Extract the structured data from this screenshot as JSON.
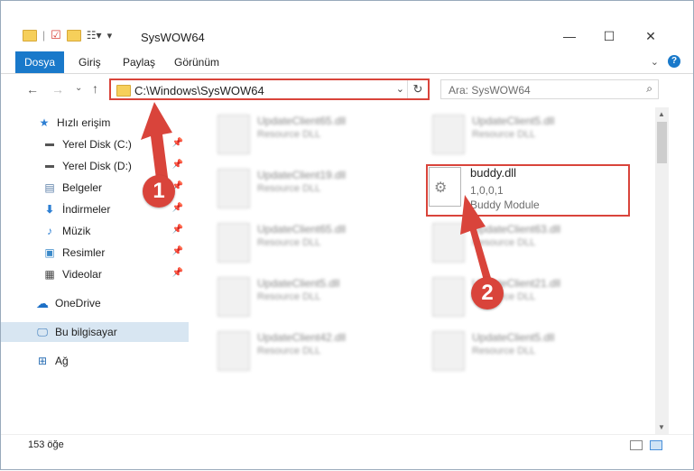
{
  "window": {
    "title": "SysWOW64"
  },
  "ribbon": {
    "tabs": [
      "Dosya",
      "Giriş",
      "Paylaş",
      "Görünüm"
    ]
  },
  "address": {
    "path": "C:\\Windows\\SysWOW64"
  },
  "search": {
    "placeholder": "Ara: SysWOW64"
  },
  "sidebar": {
    "items": [
      {
        "label": "Hızlı erişim",
        "icon": "star-icon",
        "pinned": false
      },
      {
        "label": "Yerel Disk (C:)",
        "icon": "drive-icon",
        "pinned": true
      },
      {
        "label": "Yerel Disk (D:)",
        "icon": "drive-icon",
        "pinned": true
      },
      {
        "label": "Belgeler",
        "icon": "documents-icon",
        "pinned": true
      },
      {
        "label": "İndirmeler",
        "icon": "download-icon",
        "pinned": true
      },
      {
        "label": "Müzik",
        "icon": "music-icon",
        "pinned": true
      },
      {
        "label": "Resimler",
        "icon": "pictures-icon",
        "pinned": true
      },
      {
        "label": "Videolar",
        "icon": "videos-icon",
        "pinned": true
      },
      {
        "label": "OneDrive",
        "icon": "cloud-icon",
        "pinned": false
      },
      {
        "label": "Bu bilgisayar",
        "icon": "computer-icon",
        "pinned": false
      },
      {
        "label": "Ağ",
        "icon": "network-icon",
        "pinned": false
      }
    ]
  },
  "files": {
    "left": [
      {
        "name": "UpdateClient65.dll",
        "desc": "Resource DLL"
      },
      {
        "name": "UpdateClient19.dll",
        "desc": "Resource DLL"
      },
      {
        "name": "UpdateClient65.dll",
        "desc": "Resource DLL"
      },
      {
        "name": "UpdateClient5.dll",
        "desc": "Resource DLL"
      },
      {
        "name": "UpdateClient42.dll",
        "desc": "Resource DLL"
      }
    ],
    "right": [
      {
        "name": "UpdateClient5.dll",
        "desc": "Resource DLL"
      },
      {
        "name": "buddy.dll",
        "version": "1,0,0,1",
        "desc": "Buddy Module"
      },
      {
        "name": "UpdateClient63.dll",
        "desc": "Resource DLL"
      },
      {
        "name": "UpdateClient21.dll",
        "desc": "Resource DLL"
      },
      {
        "name": "UpdateClient5.dll",
        "desc": "Resource DLL"
      }
    ]
  },
  "status": {
    "count": "153 öğe"
  },
  "annotations": {
    "step1": "1",
    "step2": "2",
    "color": "#d9443b"
  }
}
